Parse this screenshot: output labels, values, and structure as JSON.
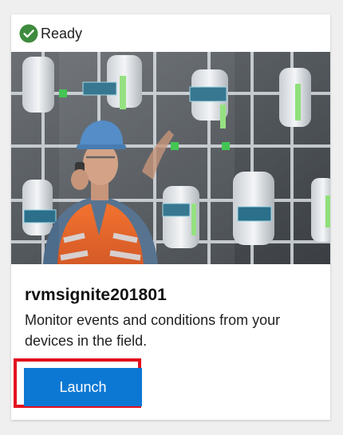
{
  "card": {
    "status": {
      "icon": "check-circle-icon",
      "text": "Ready",
      "color": "#3e8b3e"
    },
    "image": {
      "subject": "worker-with-radio-in-industrial-control-room"
    },
    "app_name": "rvmsignite201801",
    "description": "Monitor events and conditions from your devices in the field.",
    "launch_label": "Launch",
    "accent_color": "#0d78d4",
    "highlight_color": "#e3101e"
  }
}
